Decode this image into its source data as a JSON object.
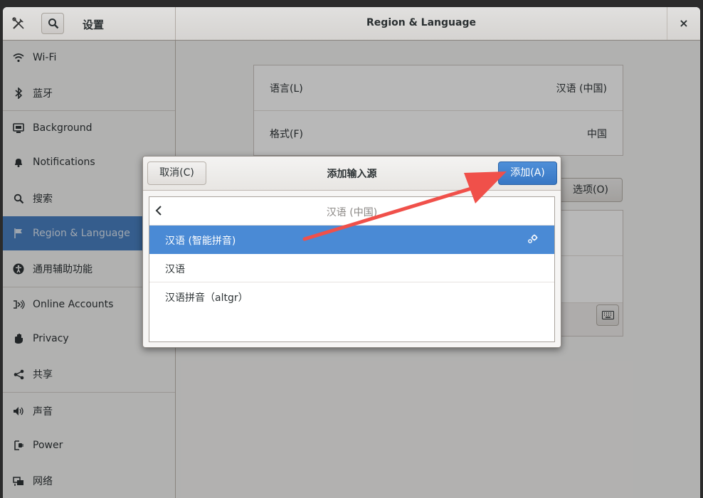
{
  "header": {
    "app_title": "设置",
    "page_title": "Region & Language",
    "close_label": "×"
  },
  "sidebar": {
    "items": [
      {
        "label": "Wi-Fi",
        "icon": "wifi-icon"
      },
      {
        "label": "蓝牙",
        "icon": "bluetooth-icon"
      },
      {
        "label": "Background",
        "icon": "background-icon"
      },
      {
        "label": "Notifications",
        "icon": "bell-icon"
      },
      {
        "label": "搜索",
        "icon": "search-icon"
      },
      {
        "label": "Region & Language",
        "icon": "region-flag-icon",
        "selected": true
      },
      {
        "label": "通用辅助功能",
        "icon": "accessibility-icon"
      },
      {
        "label": "Online Accounts",
        "icon": "online-accounts-icon"
      },
      {
        "label": "Privacy",
        "icon": "hand-icon"
      },
      {
        "label": "共享",
        "icon": "share-icon"
      },
      {
        "label": "声音",
        "icon": "speaker-icon"
      },
      {
        "label": "Power",
        "icon": "power-icon"
      },
      {
        "label": "网络",
        "icon": "network-icon"
      }
    ]
  },
  "main": {
    "language_label": "语言(L)",
    "language_value": "汉语 (中国)",
    "format_label": "格式(F)",
    "format_value": "中国",
    "options_button": "选项(O)"
  },
  "dialog": {
    "title": "添加输入源",
    "cancel_label": "取消(C)",
    "add_label": "添加(A)",
    "list_header": "汉语 (中国)",
    "items": [
      {
        "label": "汉语 (智能拼音)",
        "selected": true,
        "has_settings": true
      },
      {
        "label": "汉语",
        "selected": false
      },
      {
        "label": "汉语拼音（altgr）",
        "selected": false
      }
    ]
  },
  "colors": {
    "accent": "#4a8ad5",
    "annotation_arrow": "#f0504a"
  }
}
